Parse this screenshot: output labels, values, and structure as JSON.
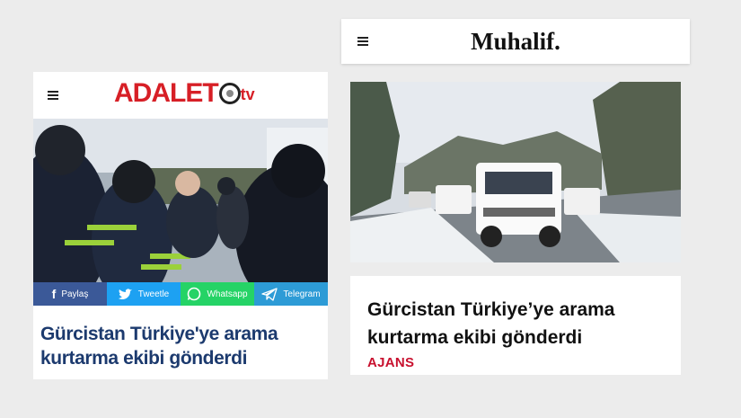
{
  "left": {
    "logo_text": "ADALET",
    "logo_suffix": "tv",
    "share_buttons": [
      {
        "label": "Paylaş",
        "icon": "facebook-icon",
        "color": "#3b5998"
      },
      {
        "label": "Tweetle",
        "icon": "twitter-icon",
        "color": "#1da1f2"
      },
      {
        "label": "Whatsapp",
        "icon": "whatsapp-icon",
        "color": "#25d366"
      },
      {
        "label": "Telegram",
        "icon": "telegram-icon",
        "color": "#2d9bd6"
      }
    ],
    "headline": "Gürcistan Türkiye'ye arama kurtarma ekibi gönderdi",
    "headline_color": "#1c3a6e",
    "brand_color": "#d71f26"
  },
  "right": {
    "logo_text": "Muhalif.",
    "headline": "Gürcistan Türkiye’ye arama kurtarma ekibi gönderdi",
    "source": "AJANS",
    "source_color": "#c8102e"
  }
}
